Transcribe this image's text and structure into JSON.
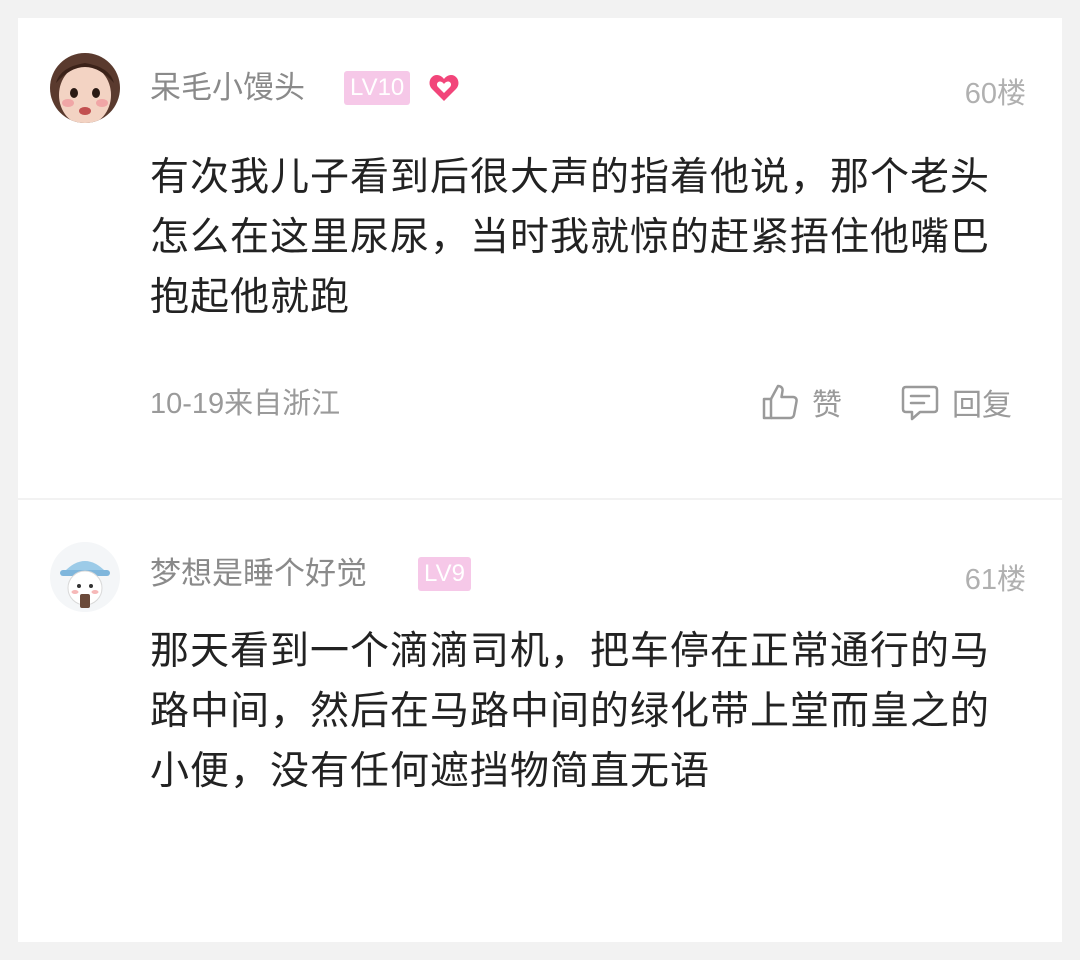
{
  "comments": [
    {
      "username": "呆毛小馒头",
      "level": "LV10",
      "floor": "60楼",
      "content": "有次我儿子看到后很大声的指着他说，那个老头怎么在这里尿尿，当时我就惊的赶紧捂住他嘴巴抱起他就跑",
      "meta": "10-19来自浙江",
      "like_label": "赞",
      "reply_label": "回复",
      "has_heart_badge": true
    },
    {
      "username": "梦想是睡个好觉",
      "level": "LV9",
      "floor": "61楼",
      "content": "那天看到一个滴滴司机，把车停在正常通行的马路中间，然后在马路中间的绿化带上堂而皇之的小便，没有任何遮挡物简直无语"
    }
  ],
  "colors": {
    "level_badge": "#f6c8e8",
    "heart": "#f2457a",
    "username": "#8a8a8a",
    "content": "#222222",
    "background": "#f2f2f2"
  },
  "icons": [
    "heart-icon",
    "thumbs-up-icon",
    "comment-icon"
  ]
}
